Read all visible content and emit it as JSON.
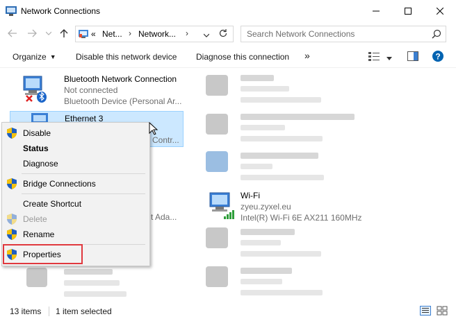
{
  "window": {
    "title": "Network Connections",
    "minimize_glyph": "—",
    "maximize_glyph": "☐",
    "close_glyph": "✕"
  },
  "address_bar": {
    "overflow": "«",
    "crumbs": [
      "Net...",
      "Network..."
    ],
    "separator": "›"
  },
  "search": {
    "placeholder": "Search Network Connections"
  },
  "toolbar": {
    "organize": "Organize",
    "disable_device": "Disable this network device",
    "diagnose": "Diagnose this connection",
    "more": "»"
  },
  "connections": [
    {
      "name": "Bluetooth Network Connection",
      "status": "Not connected",
      "device": "Bluetooth Device (Personal Ar..."
    },
    {
      "name": "Ethernet 3",
      "status": "",
      "device": "Contr..."
    },
    {
      "name": "Wi-Fi",
      "status": "zyeu.zyxel.eu",
      "device": "Intel(R) Wi-Fi 6E AX211 160MHz"
    }
  ],
  "partial_text": {
    "adapter_fragment": "t Ada..."
  },
  "context_menu": {
    "items": [
      {
        "label": "Disable"
      },
      {
        "label": "Status"
      },
      {
        "label": "Diagnose"
      },
      {
        "label": "Bridge Connections"
      },
      {
        "label": "Create Shortcut"
      },
      {
        "label": "Delete"
      },
      {
        "label": "Rename"
      },
      {
        "label": "Properties"
      }
    ]
  },
  "status_bar": {
    "item_count": "13 items",
    "selection": "1 item selected"
  },
  "colors": {
    "selection_bg": "#cce8ff",
    "selection_border": "#99d1ff",
    "highlight_box": "#e0383e",
    "help_blue": "#0063b1",
    "shield_blue": "#1f5fbf",
    "shield_yellow": "#f4c20d"
  }
}
